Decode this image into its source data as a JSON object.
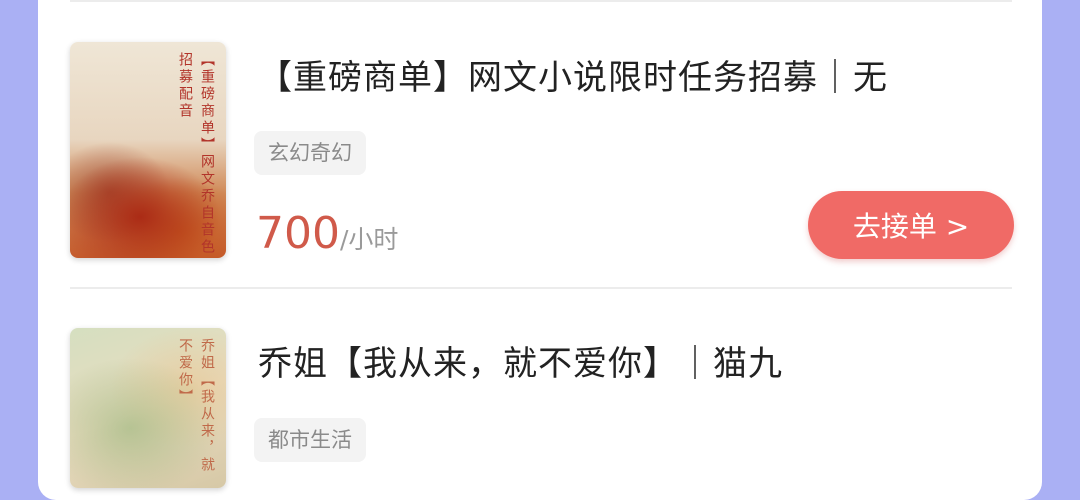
{
  "items": [
    {
      "title": "【重磅商单】网文小说限时任务招募｜无",
      "cover_text": "【重磅商单】网文乔自音色招募配音",
      "tag": "玄幻奇幻",
      "price": "700",
      "unit": "/小时",
      "button_label": "去接单 >",
      "colors": {
        "price": "#d05a4a",
        "button": "#f06a66"
      }
    },
    {
      "title": "乔姐【我从来，就不爱你】｜猫九",
      "cover_text": "乔姐【我从来，就不爱你】",
      "tag": "都市生活"
    }
  ]
}
